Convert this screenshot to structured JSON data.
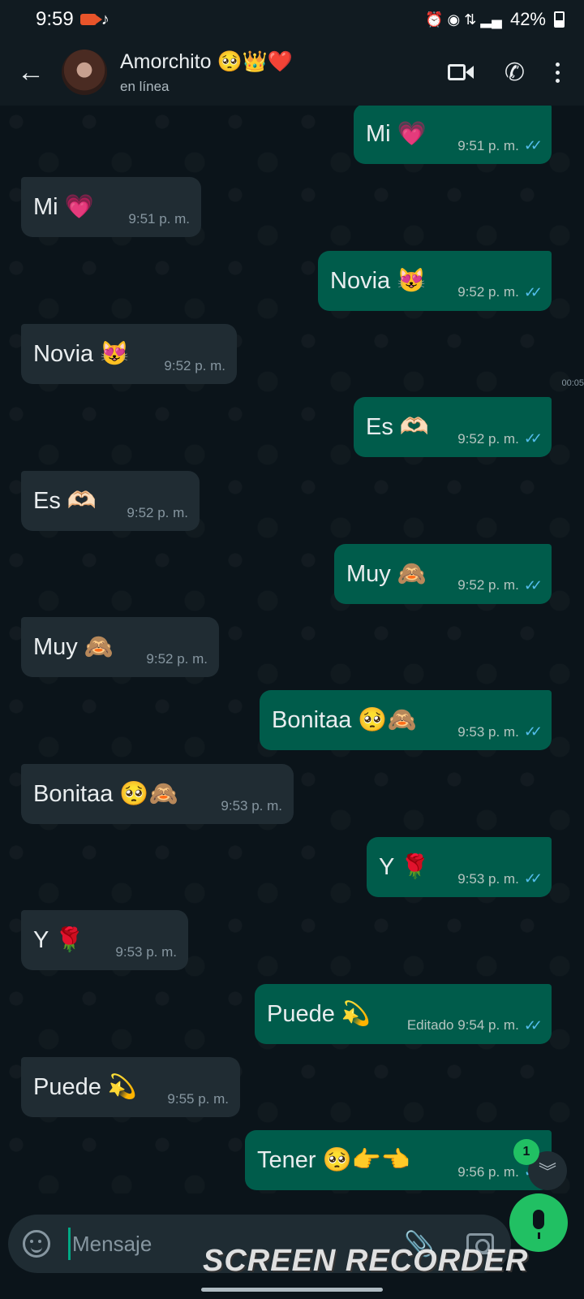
{
  "status_bar": {
    "time": "9:59",
    "tiktok_icon": "♪",
    "right_icons": "⏰ ◉ ⇅ ▂▄",
    "battery_text": "42%",
    "battery_level": 0.42
  },
  "header": {
    "contact_name": "Amorchito 🥺👑❤️",
    "status": "en línea",
    "back_icon": "←",
    "phone_icon": "✆"
  },
  "side_label": "00:05",
  "messages": [
    {
      "dir": "out",
      "text": "Mi 💗",
      "time": "9:51 p. m.",
      "read": "✓✓"
    },
    {
      "dir": "in",
      "text": "Mi 💗",
      "time": "9:51 p. m."
    },
    {
      "dir": "out",
      "text": "Novia 😻",
      "time": "9:52 p. m.",
      "read": "✓✓"
    },
    {
      "dir": "in",
      "text": "Novia 😻",
      "time": "9:52 p. m."
    },
    {
      "dir": "out",
      "text": "Es 🫶🏻",
      "time": "9:52 p. m.",
      "read": "✓✓"
    },
    {
      "dir": "in",
      "text": "Es 🫶🏻",
      "time": "9:52 p. m."
    },
    {
      "dir": "out",
      "text": "Muy 🙈",
      "time": "9:52 p. m.",
      "read": "✓✓"
    },
    {
      "dir": "in",
      "text": "Muy 🙈",
      "time": "9:52 p. m."
    },
    {
      "dir": "out",
      "text": "Bonitaa 🥺🙈",
      "time": "9:53 p. m.",
      "read": "✓✓"
    },
    {
      "dir": "in",
      "text": "Bonitaa 🥺🙈",
      "time": "9:53 p. m."
    },
    {
      "dir": "out",
      "text": "Y 🌹",
      "time": "9:53 p. m.",
      "read": "✓✓"
    },
    {
      "dir": "in",
      "text": "Y 🌹",
      "time": "9:53 p. m."
    },
    {
      "dir": "out",
      "text": "Puede 💫",
      "time": "Editado 9:54 p. m.",
      "read": "✓✓"
    },
    {
      "dir": "in",
      "text": "Puede 💫",
      "time": "9:55 p. m."
    },
    {
      "dir": "out",
      "text": "Tener 🥺👉👈",
      "time": "9:56 p. m.",
      "read": "✓✓"
    }
  ],
  "unread_badge": "1",
  "scroll_down_icon": "︾",
  "composer": {
    "placeholder": "Mensaje",
    "attach_icon": "📎"
  },
  "watermark": "SCREEN RECORDER",
  "colors": {
    "outgoing_bubble": "#005c4b",
    "incoming_bubble": "#202c33",
    "accent_green": "#21c063",
    "read_ticks": "#53bdeb"
  }
}
